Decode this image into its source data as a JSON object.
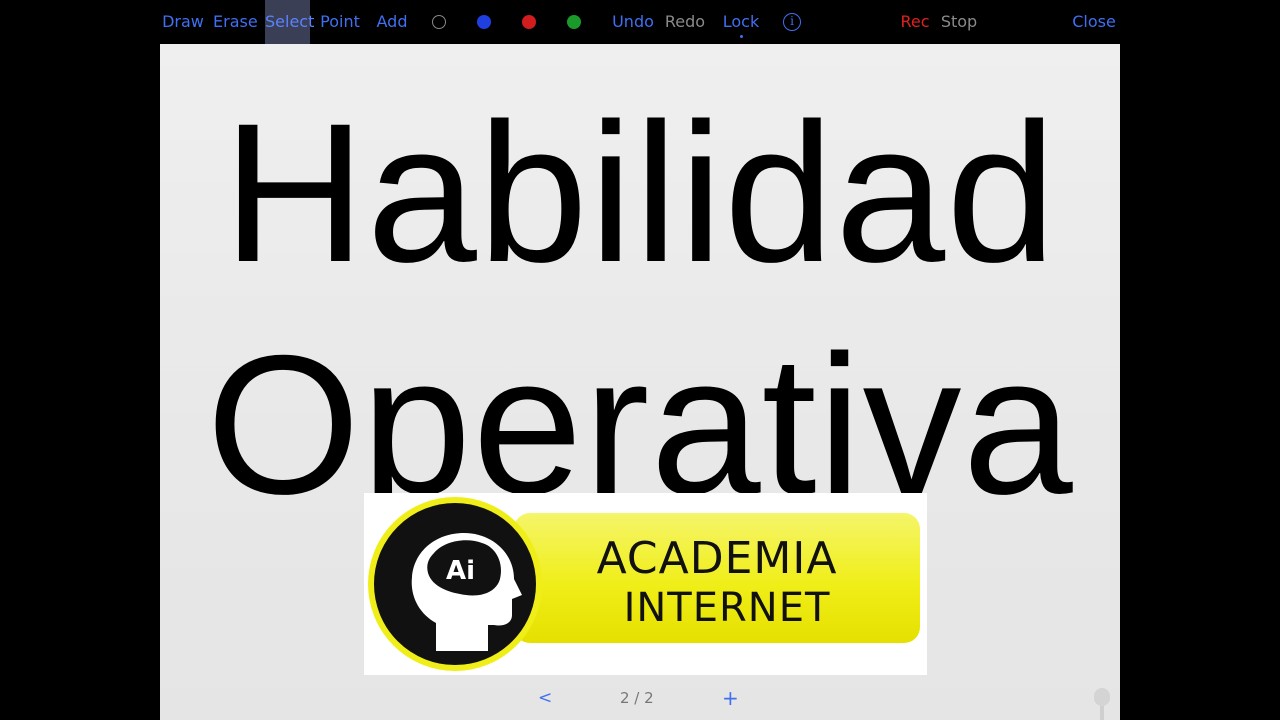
{
  "toolbar": {
    "draw": "Draw",
    "erase": "Erase",
    "select": "Select",
    "point": "Point",
    "add": "Add",
    "undo": "Undo",
    "redo": "Redo",
    "lock": "Lock",
    "info_glyph": "i",
    "rec": "Rec",
    "stop": "Stop",
    "close": "Close",
    "colors": [
      "#000000",
      "#1f3fe0",
      "#d11d1d",
      "#1a9a2a"
    ]
  },
  "slide": {
    "title_line1": "Habilidad",
    "title_line2": "Operativa",
    "logo": {
      "badge": "Ai",
      "line1": "ACADEMIA",
      "line2": "INTERNET"
    }
  },
  "pager": {
    "prev": "<",
    "counter": "2 / 2",
    "next": "+"
  },
  "colors": {
    "accent": "#3f6ff2",
    "rec": "#e02020",
    "disabled": "#8a8a8a",
    "logo_yellow": "#f0ee18"
  }
}
